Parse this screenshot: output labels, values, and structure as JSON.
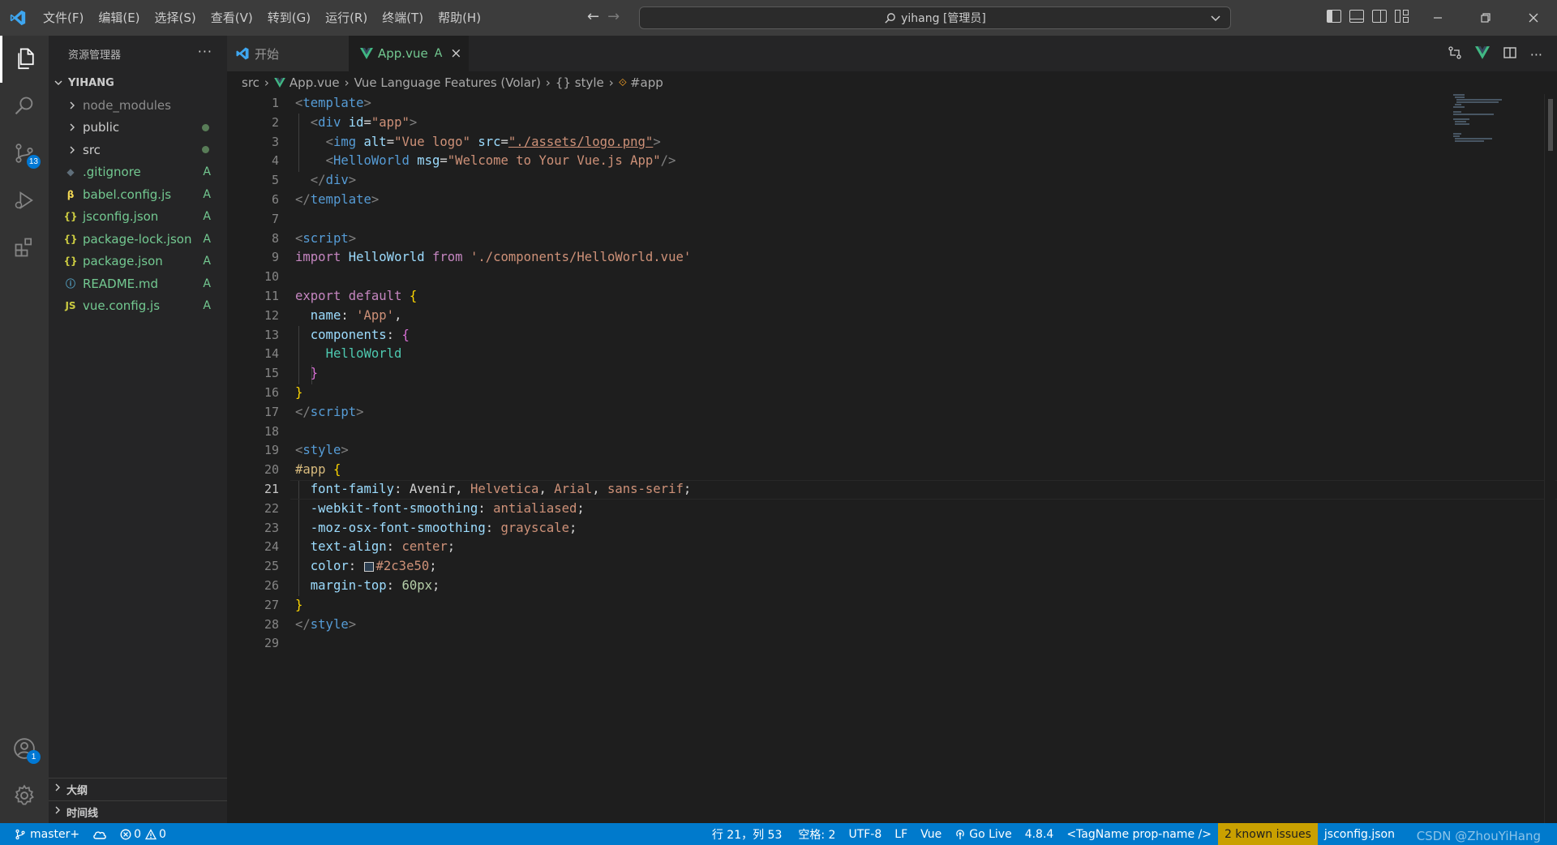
{
  "titlebar": {
    "menu": [
      "文件(F)",
      "编辑(E)",
      "选择(S)",
      "查看(V)",
      "转到(G)",
      "运行(R)",
      "终端(T)",
      "帮助(H)"
    ],
    "command_center": "yihang [管理员]"
  },
  "activity": {
    "scm_badge": "13",
    "accounts_badge": "1"
  },
  "sidebar": {
    "title": "资源管理器",
    "folder": "YIHANG",
    "items": [
      {
        "name": "node_modules",
        "kind": "folder",
        "status": ""
      },
      {
        "name": "public",
        "kind": "folder",
        "status": "dot"
      },
      {
        "name": "src",
        "kind": "folder",
        "status": "dot"
      },
      {
        "name": ".gitignore",
        "kind": "gitignore",
        "status": "A"
      },
      {
        "name": "babel.config.js",
        "kind": "babel",
        "status": "A"
      },
      {
        "name": "jsconfig.json",
        "kind": "json",
        "status": "A"
      },
      {
        "name": "package-lock.json",
        "kind": "json",
        "status": "A"
      },
      {
        "name": "package.json",
        "kind": "json",
        "status": "A"
      },
      {
        "name": "README.md",
        "kind": "info",
        "status": "A"
      },
      {
        "name": "vue.config.js",
        "kind": "js",
        "status": "A"
      }
    ],
    "outline": "大纲",
    "timeline": "时间线"
  },
  "tabs": [
    {
      "label": "开始"
    },
    {
      "label": "App.vue",
      "modifier": "A"
    }
  ],
  "breadcrumb": [
    "src",
    "App.vue",
    "Vue Language Features (Volar)",
    "{} style",
    "#app"
  ],
  "editor": {
    "current_line": 21,
    "lines": [
      [
        [
          "t-pun",
          "<"
        ],
        [
          "t-tag",
          "template"
        ],
        [
          "t-pun",
          ">"
        ]
      ],
      [
        [
          "t-pl",
          "  "
        ],
        [
          "t-pun",
          "<"
        ],
        [
          "t-tag",
          "div"
        ],
        [
          "t-pl",
          " "
        ],
        [
          "t-at",
          "id"
        ],
        [
          "t-pl",
          "="
        ],
        [
          "t-str",
          "\"app\""
        ],
        [
          "t-pun",
          ">"
        ]
      ],
      [
        [
          "t-pl",
          "    "
        ],
        [
          "t-pun",
          "<"
        ],
        [
          "t-tag",
          "img"
        ],
        [
          "t-pl",
          " "
        ],
        [
          "t-at",
          "alt"
        ],
        [
          "t-pl",
          "="
        ],
        [
          "t-str",
          "\"Vue logo\""
        ],
        [
          "t-pl",
          " "
        ],
        [
          "t-at",
          "src"
        ],
        [
          "t-pl",
          "="
        ],
        [
          "t-str",
          "\"./assets/logo.png\""
        ],
        [
          "t-pun",
          ">"
        ]
      ],
      [
        [
          "t-pl",
          "    "
        ],
        [
          "t-pun",
          "<"
        ],
        [
          "t-tag",
          "HelloWorld"
        ],
        [
          "t-pl",
          " "
        ],
        [
          "t-at",
          "msg"
        ],
        [
          "t-pl",
          "="
        ],
        [
          "t-str",
          "\"Welcome to Your Vue.js App\""
        ],
        [
          "t-pun",
          "/>"
        ]
      ],
      [
        [
          "t-pl",
          "  "
        ],
        [
          "t-pun",
          "</"
        ],
        [
          "t-tag",
          "div"
        ],
        [
          "t-pun",
          ">"
        ]
      ],
      [
        [
          "t-pun",
          "</"
        ],
        [
          "t-tag",
          "template"
        ],
        [
          "t-pun",
          ">"
        ]
      ],
      [],
      [
        [
          "t-pun",
          "<"
        ],
        [
          "t-tag",
          "script"
        ],
        [
          "t-pun",
          ">"
        ]
      ],
      [
        [
          "t-kw",
          "import"
        ],
        [
          "t-pl",
          " "
        ],
        [
          "t-id",
          "HelloWorld"
        ],
        [
          "t-pl",
          " "
        ],
        [
          "t-kw",
          "from"
        ],
        [
          "t-pl",
          " "
        ],
        [
          "t-str",
          "'./components/HelloWorld.vue'"
        ]
      ],
      [],
      [
        [
          "t-kw",
          "export"
        ],
        [
          "t-pl",
          " "
        ],
        [
          "t-kw",
          "default"
        ],
        [
          "t-pl",
          " "
        ],
        [
          "t-br1",
          "{"
        ]
      ],
      [
        [
          "t-pl",
          "  "
        ],
        [
          "t-id",
          "name"
        ],
        [
          "t-pl",
          ": "
        ],
        [
          "t-str",
          "'App'"
        ],
        [
          "t-pl",
          ","
        ]
      ],
      [
        [
          "t-pl",
          "  "
        ],
        [
          "t-id",
          "components"
        ],
        [
          "t-pl",
          ": "
        ],
        [
          "t-br2",
          "{"
        ]
      ],
      [
        [
          "t-pl",
          "    "
        ],
        [
          "t-comp",
          "HelloWorld"
        ]
      ],
      [
        [
          "t-pl",
          "  "
        ],
        [
          "t-br2",
          "}"
        ]
      ],
      [
        [
          "t-br1",
          "}"
        ]
      ],
      [
        [
          "t-pun",
          "</"
        ],
        [
          "t-tag",
          "script"
        ],
        [
          "t-pun",
          ">"
        ]
      ],
      [],
      [
        [
          "t-pun",
          "<"
        ],
        [
          "t-tag",
          "style"
        ],
        [
          "t-pun",
          ">"
        ]
      ],
      [
        [
          "t-cls",
          "#app"
        ],
        [
          "t-pl",
          " "
        ],
        [
          "t-br1",
          "{"
        ]
      ],
      [
        [
          "t-pl",
          "  "
        ],
        [
          "t-id",
          "font-family"
        ],
        [
          "t-pl",
          ": Avenir, "
        ],
        [
          "t-val",
          "Helvetica"
        ],
        [
          "t-pl",
          ", "
        ],
        [
          "t-val",
          "Arial"
        ],
        [
          "t-pl",
          ", "
        ],
        [
          "t-val",
          "sans-serif"
        ],
        [
          "t-pl",
          ";"
        ]
      ],
      [
        [
          "t-pl",
          "  "
        ],
        [
          "t-id",
          "-webkit-font-smoothing"
        ],
        [
          "t-pl",
          ": "
        ],
        [
          "t-val",
          "antialiased"
        ],
        [
          "t-pl",
          ";"
        ]
      ],
      [
        [
          "t-pl",
          "  "
        ],
        [
          "t-id",
          "-moz-osx-font-smoothing"
        ],
        [
          "t-pl",
          ": "
        ],
        [
          "t-val",
          "grayscale"
        ],
        [
          "t-pl",
          ";"
        ]
      ],
      [
        [
          "t-pl",
          "  "
        ],
        [
          "t-id",
          "text-align"
        ],
        [
          "t-pl",
          ": "
        ],
        [
          "t-val",
          "center"
        ],
        [
          "t-pl",
          ";"
        ]
      ],
      [
        [
          "t-pl",
          "  "
        ],
        [
          "t-id",
          "color"
        ],
        [
          "t-pl",
          ": "
        ],
        [
          "swatch",
          ""
        ],
        [
          "t-val",
          "#2c3e50"
        ],
        [
          "t-pl",
          ";"
        ]
      ],
      [
        [
          "t-pl",
          "  "
        ],
        [
          "t-id",
          "margin-top"
        ],
        [
          "t-pl",
          ": "
        ],
        [
          "t-num",
          "60px"
        ],
        [
          "t-pl",
          ";"
        ]
      ],
      [
        [
          "t-br1",
          "}"
        ]
      ],
      [
        [
          "t-pun",
          "</"
        ],
        [
          "t-tag",
          "style"
        ],
        [
          "t-pun",
          ">"
        ]
      ],
      []
    ]
  },
  "statusbar": {
    "branch": "master+",
    "errors": "0",
    "warnings": "0",
    "position": "行 21，列 53",
    "spaces": "空格: 2",
    "encoding": "UTF-8",
    "eol": "LF",
    "language": "Vue",
    "golive": "Go Live",
    "version": "4.8.4",
    "tagname": "<TagName prop-name />",
    "issues": "2 known issues",
    "config": "jsconfig.json"
  },
  "watermark": "CSDN @ZhouYiHang",
  "colors": {
    "accent": "#007acc",
    "added": "#73c991",
    "warning_badge": "#c9a000"
  }
}
